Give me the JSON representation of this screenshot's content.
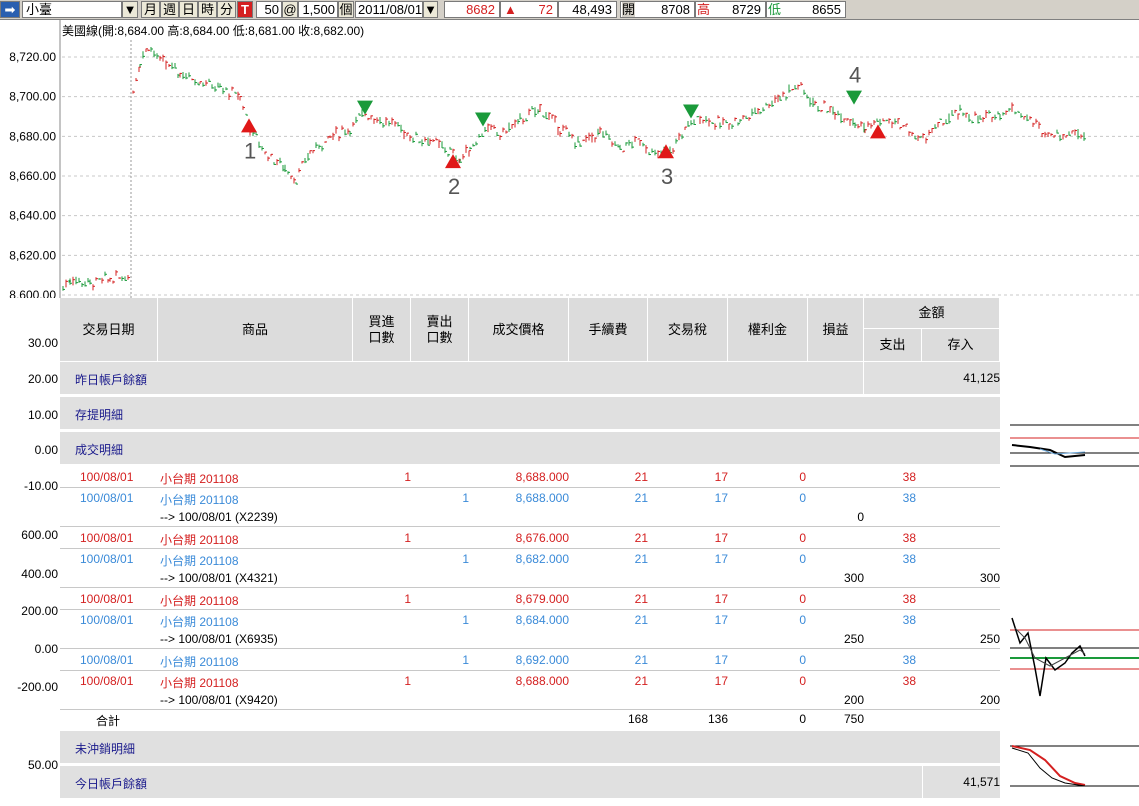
{
  "toolbar": {
    "symbol": "小臺",
    "period_buttons": [
      "月",
      "週",
      "日",
      "時",
      "分"
    ],
    "marker": "T",
    "lots": "50",
    "at": "@",
    "price_amount": "1,500",
    "unit": "個",
    "date": "2011/08/01",
    "last": "8682",
    "change": "72",
    "volume": "48,493",
    "open_label": "開",
    "open_value": "8708",
    "high_label": "高",
    "high_value": "8729",
    "low_label": "低",
    "low_value": "8655"
  },
  "chart_header": "美國線(開:8,684.00 高:8,684.00 低:8,681.00 收:8,682.00)",
  "chart_data": {
    "type": "line",
    "ylim": [
      8600,
      8730
    ],
    "y_ticks": [
      "8,720.00",
      "8,700.00",
      "8,680.00",
      "8,660.00",
      "8,640.00",
      "8,620.00",
      "8,600.00"
    ],
    "markers": [
      {
        "label": "1",
        "type": "buy",
        "price": 8685
      },
      {
        "label": "2",
        "type": "buy",
        "price": 8667
      },
      {
        "label": "3",
        "type": "buy",
        "price": 8672
      },
      {
        "label": "4",
        "type": "sell",
        "price": 8699
      },
      {
        "type": "sell",
        "price": 8694
      },
      {
        "type": "sell",
        "price": 8688
      },
      {
        "type": "sell",
        "price": 8692
      },
      {
        "type": "buy",
        "price": 8682
      }
    ]
  },
  "left_scales": [
    "30.00",
    "20.00",
    "10.00",
    "0.00",
    "-10.00",
    "600.00",
    "400.00",
    "200.00",
    "0.00",
    "-200.00",
    "50.00"
  ],
  "table": {
    "headers": {
      "date": "交易日期",
      "product": "商品",
      "buy": "買進\n口數",
      "sell": "賣出\n口數",
      "price": "成交價格",
      "fee": "手續費",
      "tax": "交易稅",
      "premium": "權利金",
      "pnl": "損益",
      "amount": "金額",
      "out": "支出",
      "in": "存入"
    },
    "prev_balance_label": "昨日帳戶餘額",
    "prev_balance": "41,125",
    "deposit_label": "存提明細",
    "trades_label": "成交明細",
    "rows": [
      {
        "kind": "buy",
        "date": "100/08/01",
        "product": "小台期 201108",
        "buy": "1",
        "sell": "",
        "price": "8,688.000",
        "fee": "21",
        "tax": "17",
        "premium": "0",
        "pnl": "",
        "out": "38",
        "in": ""
      },
      {
        "kind": "sell",
        "date": "100/08/01",
        "product": "小台期 201108",
        "buy": "",
        "sell": "1",
        "price": "8,688.000",
        "fee": "21",
        "tax": "17",
        "premium": "0",
        "pnl": "",
        "out": "38",
        "in": ""
      },
      {
        "kind": "close",
        "ref": "--> 100/08/01 (X2239)",
        "pnl": "0",
        "in": ""
      },
      {
        "kind": "buy",
        "date": "100/08/01",
        "product": "小台期 201108",
        "buy": "1",
        "sell": "",
        "price": "8,676.000",
        "fee": "21",
        "tax": "17",
        "premium": "0",
        "pnl": "",
        "out": "38",
        "in": ""
      },
      {
        "kind": "sell",
        "date": "100/08/01",
        "product": "小台期 201108",
        "buy": "",
        "sell": "1",
        "price": "8,682.000",
        "fee": "21",
        "tax": "17",
        "premium": "0",
        "pnl": "",
        "out": "38",
        "in": ""
      },
      {
        "kind": "close",
        "ref": "--> 100/08/01 (X4321)",
        "pnl": "300",
        "in": "300"
      },
      {
        "kind": "buy",
        "date": "100/08/01",
        "product": "小台期 201108",
        "buy": "1",
        "sell": "",
        "price": "8,679.000",
        "fee": "21",
        "tax": "17",
        "premium": "0",
        "pnl": "",
        "out": "38",
        "in": ""
      },
      {
        "kind": "sell",
        "date": "100/08/01",
        "product": "小台期 201108",
        "buy": "",
        "sell": "1",
        "price": "8,684.000",
        "fee": "21",
        "tax": "17",
        "premium": "0",
        "pnl": "",
        "out": "38",
        "in": ""
      },
      {
        "kind": "close",
        "ref": "--> 100/08/01 (X6935)",
        "pnl": "250",
        "in": "250"
      },
      {
        "kind": "sell",
        "date": "100/08/01",
        "product": "小台期 201108",
        "buy": "",
        "sell": "1",
        "price": "8,692.000",
        "fee": "21",
        "tax": "17",
        "premium": "0",
        "pnl": "",
        "out": "38",
        "in": ""
      },
      {
        "kind": "buy",
        "date": "100/08/01",
        "product": "小台期 201108",
        "buy": "1",
        "sell": "",
        "price": "8,688.000",
        "fee": "21",
        "tax": "17",
        "premium": "0",
        "pnl": "",
        "out": "38",
        "in": ""
      },
      {
        "kind": "close",
        "ref": "--> 100/08/01 (X9420)",
        "pnl": "200",
        "in": "200"
      }
    ],
    "total_label": "合計",
    "total_fee": "168",
    "total_tax": "136",
    "total_premium": "0",
    "total_pnl": "750",
    "open_positions_label": "未沖銷明細",
    "today_balance_label": "今日帳戶餘額",
    "today_balance": "41,571"
  },
  "colors": {
    "up": "#d42020",
    "down": "#1a9a3a",
    "buy_text": "#d42020",
    "sell_text": "#3a8ad8"
  }
}
